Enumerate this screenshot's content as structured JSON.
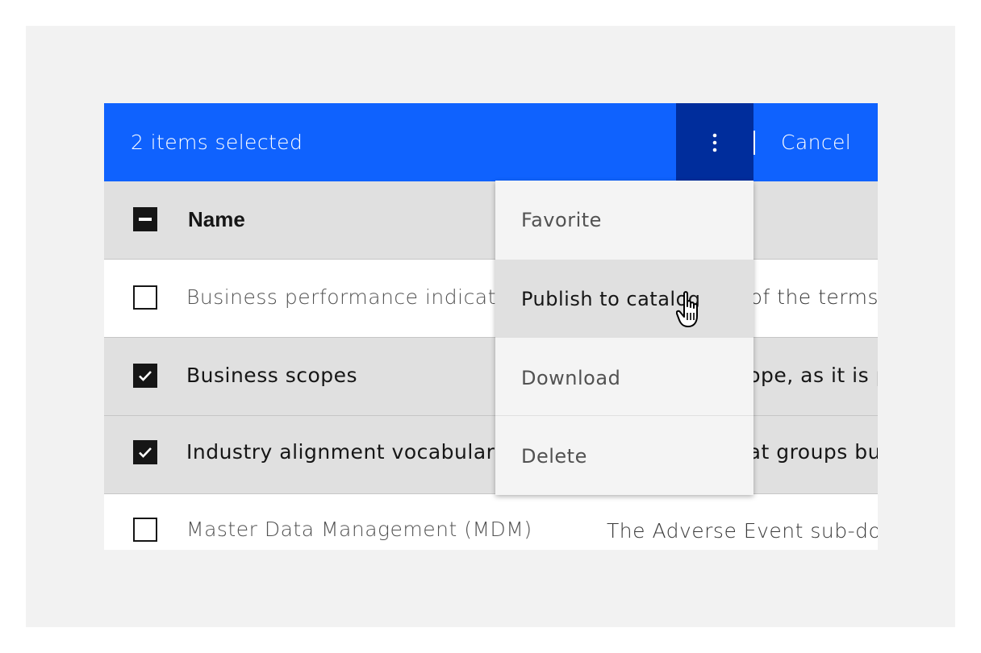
{
  "batch_bar": {
    "selected_count_text": "2 items selected",
    "overflow_icon": "overflow-menu-vertical-icon",
    "cancel_label": "Cancel"
  },
  "table": {
    "columns": [
      "Name"
    ],
    "rows": [
      {
        "name": "Business performance indicators",
        "description": "The mapping of the terms",
        "checked": false
      },
      {
        "name": "Business scopes",
        "description": "A business scope, as it is part of the",
        "checked": true
      },
      {
        "name": "Industry alignment vocabularies",
        "description": "A category that groups business",
        "checked": true
      },
      {
        "name": "Master Data Management (MDM)",
        "description": "The Adverse Event sub-domain",
        "checked": false
      }
    ]
  },
  "menu": {
    "items": [
      {
        "label": "Favorite"
      },
      {
        "label": "Publish to catalog",
        "hovered": true
      },
      {
        "label": "Download"
      },
      {
        "label": "Delete"
      }
    ]
  },
  "colors": {
    "batch_bar": "#0f62fe",
    "overflow_active": "#002d9c",
    "selected_row": "#e0e0e0",
    "menu_bg": "#f4f4f4"
  }
}
